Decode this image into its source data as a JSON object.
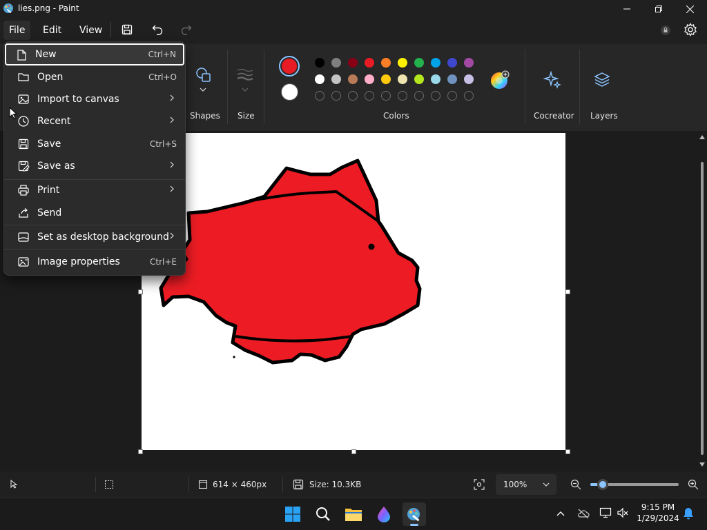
{
  "window": {
    "title": "lies.png - Paint"
  },
  "menubar": {
    "file": "File",
    "edit": "Edit",
    "view": "View"
  },
  "ribbon": {
    "shapes_label": "Shapes",
    "size_label": "Size",
    "colors_label": "Colors",
    "cocreator_label": "Cocreator",
    "layers_label": "Layers",
    "primary_color": "#e81c24",
    "secondary_color": "#ffffff",
    "palette_row1": [
      "#000000",
      "#7f7f7f",
      "#880015",
      "#e81c24",
      "#ff7f27",
      "#fff200",
      "#22b14c",
      "#00a2e8",
      "#3f48cc",
      "#a349a4"
    ],
    "palette_row2": [
      "#ffffff",
      "#c3c3c3",
      "#b97a57",
      "#ffaec9",
      "#ffc90e",
      "#efe4b0",
      "#b5e61d",
      "#99d9ea",
      "#7092be",
      "#c8bfe7"
    ]
  },
  "file_menu": {
    "items": [
      {
        "label": "New",
        "shortcut": "Ctrl+N"
      },
      {
        "label": "Open",
        "shortcut": "Ctrl+O"
      },
      {
        "label": "Import to canvas",
        "shortcut": ""
      },
      {
        "label": "Recent",
        "shortcut": ""
      },
      {
        "label": "Save",
        "shortcut": "Ctrl+S"
      },
      {
        "label": "Save as",
        "shortcut": ""
      },
      {
        "label": "Print",
        "shortcut": ""
      },
      {
        "label": "Send",
        "shortcut": ""
      },
      {
        "label": "Set as desktop background",
        "shortcut": ""
      },
      {
        "label": "Image properties",
        "shortcut": "Ctrl+E"
      }
    ]
  },
  "canvas": {
    "fish_color": "#ed1c24"
  },
  "status": {
    "dimensions": "614 × 460px",
    "size": "Size: 10.3KB",
    "zoom": "100%",
    "zoom_fraction": 0.08
  },
  "taskbar": {
    "time": "9:15 PM",
    "date": "1/29/2024"
  }
}
